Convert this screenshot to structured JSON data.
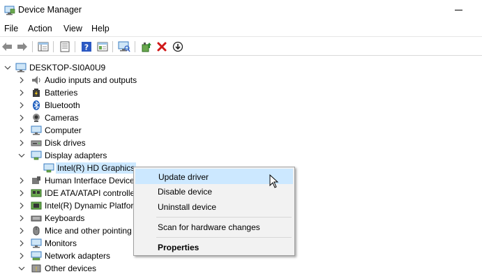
{
  "window": {
    "title": "Device Manager"
  },
  "menu": {
    "items": [
      "File",
      "Action",
      "View",
      "Help"
    ]
  },
  "toolbar": {
    "buttons": [
      "back-icon",
      "forward-icon",
      "show-hide-console-tree-icon",
      "properties-icon",
      "help-icon",
      "view-icon",
      "scan-hardware-icon",
      "update-driver-icon",
      "uninstall-icon",
      "disable-icon"
    ]
  },
  "tree": {
    "root": "DESKTOP-SI0A0U9",
    "items": [
      {
        "label": "Audio inputs and outputs",
        "icon": "speaker-icon"
      },
      {
        "label": "Batteries",
        "icon": "battery-icon"
      },
      {
        "label": "Bluetooth",
        "icon": "bluetooth-icon"
      },
      {
        "label": "Cameras",
        "icon": "camera-icon"
      },
      {
        "label": "Computer",
        "icon": "computer-icon"
      },
      {
        "label": "Disk drives",
        "icon": "disk-icon"
      },
      {
        "label": "Display adapters",
        "icon": "display-adapter-icon"
      },
      {
        "label": "Intel(R) HD Graphics",
        "icon": "display-adapter-icon"
      },
      {
        "label": "Human Interface Device",
        "icon": "hid-icon"
      },
      {
        "label": "IDE ATA/ATAPI controlle",
        "icon": "ide-icon"
      },
      {
        "label": "Intel(R) Dynamic Platfor",
        "icon": "chip-icon"
      },
      {
        "label": "Keyboards",
        "icon": "keyboard-icon"
      },
      {
        "label": "Mice and other pointing",
        "icon": "mouse-icon"
      },
      {
        "label": "Monitors",
        "icon": "monitor-icon"
      },
      {
        "label": "Network adapters",
        "icon": "network-icon"
      },
      {
        "label": "Other devices",
        "icon": "other-devices-icon"
      }
    ]
  },
  "context_menu": {
    "items": [
      "Update driver",
      "Disable device",
      "Uninstall device",
      "Scan for hardware changes",
      "Properties"
    ]
  }
}
